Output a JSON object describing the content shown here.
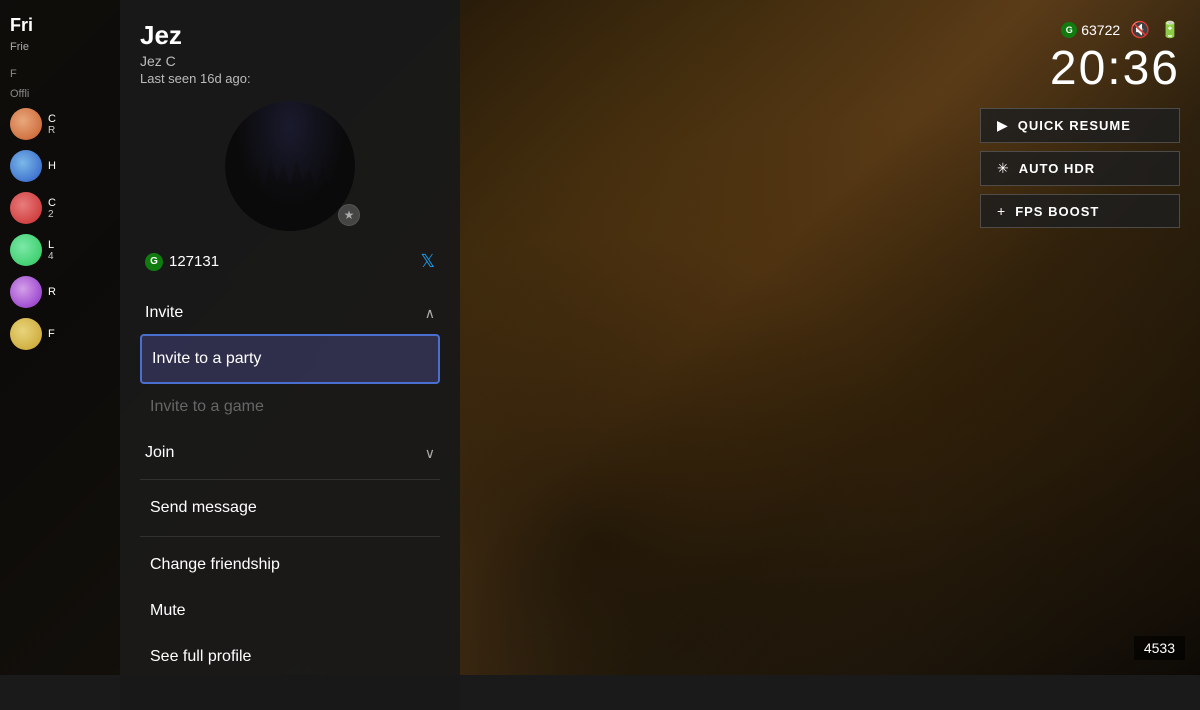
{
  "background": {
    "color_start": "#2a1f0e",
    "color_end": "#0d0a06"
  },
  "sidebar": {
    "title": "Fri",
    "subtitle": "Frie",
    "section_label": "F",
    "offline_label": "Offli",
    "friends": [
      {
        "id": "f1",
        "name": "C",
        "detail": "R",
        "avatar_class": "avatar-f1"
      },
      {
        "id": "f2",
        "name": "H",
        "detail": "",
        "avatar_class": "avatar-f2"
      },
      {
        "id": "f3",
        "name": "C",
        "detail": "2",
        "avatar_class": "avatar-f3"
      },
      {
        "id": "f4",
        "name": "L",
        "detail": "4",
        "avatar_class": "avatar-f4"
      },
      {
        "id": "f5",
        "name": "R",
        "detail": "",
        "avatar_class": "avatar-f5"
      },
      {
        "id": "f6",
        "name": "F",
        "detail": "",
        "avatar_class": "avatar-f6"
      }
    ]
  },
  "profile": {
    "name": "Jez",
    "gamertag": "Jez C",
    "last_seen": "Last seen 16d ago:",
    "gamerscore": "127131",
    "has_twitter": true,
    "star_icon": "★"
  },
  "menu": {
    "invite_section": {
      "label": "Invite",
      "expanded": true,
      "items": [
        {
          "id": "invite-party",
          "label": "Invite to a party",
          "selected": true,
          "disabled": false
        },
        {
          "id": "invite-game",
          "label": "Invite to a game",
          "selected": false,
          "disabled": true
        }
      ]
    },
    "join_section": {
      "label": "Join",
      "expanded": false
    },
    "standalone_items": [
      {
        "id": "send-message",
        "label": "Send message",
        "disabled": false
      },
      {
        "id": "change-friendship",
        "label": "Change friendship",
        "disabled": false
      },
      {
        "id": "mute",
        "label": "Mute",
        "disabled": false
      },
      {
        "id": "see-full-profile",
        "label": "See full profile",
        "disabled": false
      }
    ]
  },
  "hud": {
    "gamerscore": "63722",
    "time": "20:36",
    "buttons": [
      {
        "id": "quick-resume",
        "icon": "▶",
        "label": "QUICK RESUME"
      },
      {
        "id": "auto-hdr",
        "icon": "✳",
        "label": "AUTO HDR"
      },
      {
        "id": "fps-boost",
        "icon": "+",
        "label": "FPS BOOST"
      }
    ],
    "score": "4533"
  }
}
